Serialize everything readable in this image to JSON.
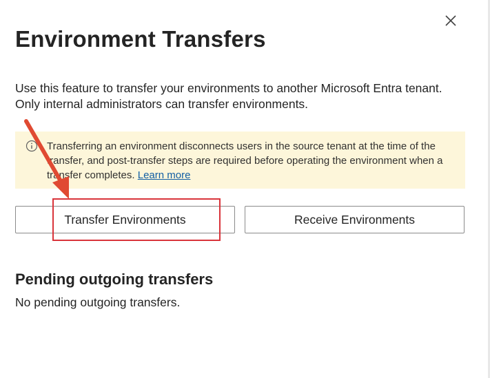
{
  "panel": {
    "title": "Environment Transfers",
    "description": "Use this feature to transfer your environments to another Microsoft Entra tenant. Only internal administrators can transfer environments.",
    "close_icon": "close-icon"
  },
  "warning": {
    "icon": "info-icon",
    "text": "Transferring an environment disconnects users in the source tenant at the time of the transfer, and post-transfer steps are required before operating the environment when a transfer completes.",
    "link_label": "Learn more"
  },
  "actions": {
    "transfer_label": "Transfer Environments",
    "receive_label": "Receive Environments"
  },
  "pending": {
    "heading": "Pending outgoing transfers",
    "empty_text": "No pending outgoing transfers."
  },
  "annotation": {
    "color": "#d9333a"
  }
}
